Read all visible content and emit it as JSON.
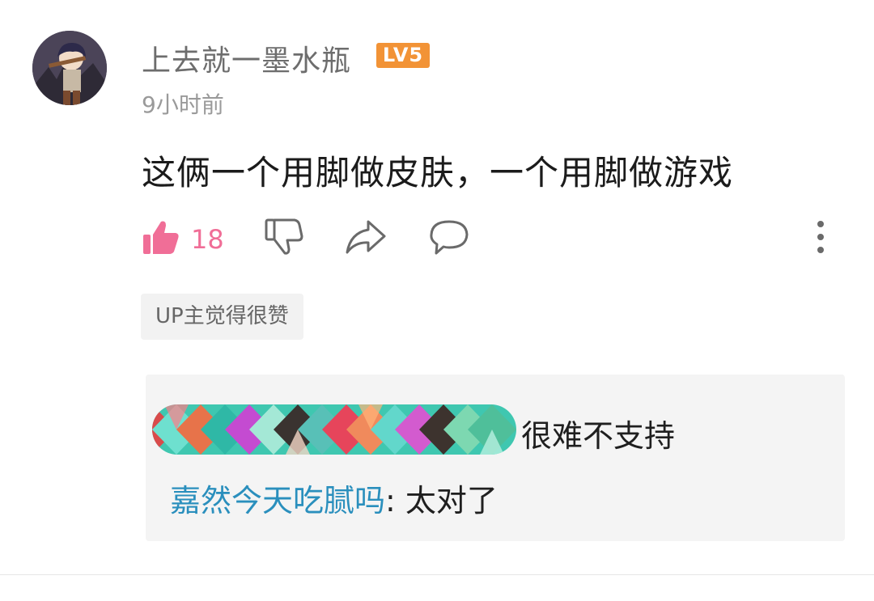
{
  "comment": {
    "username": "上去就一墨水瓶",
    "level_badge": "LV5",
    "timestamp": "9小时前",
    "content": "这俩一个用脚做皮肤，一个用脚做游戏",
    "like_count": "18",
    "up_tag": "UP主觉得很赞"
  },
  "replies": [
    {
      "username_redacted": true,
      "text": "很难不支持"
    },
    {
      "username": "嘉然今天吃腻吗",
      "separator": ": ",
      "text": "太对了"
    }
  ],
  "colors": {
    "like_accent": "#f06e97",
    "level_badge": "#f29336",
    "reply_username": "#2a8fbd"
  },
  "icons": [
    "avatar",
    "thumbs-up-icon",
    "thumbs-down-icon",
    "share-icon",
    "comment-icon",
    "more-vertical-icon"
  ]
}
